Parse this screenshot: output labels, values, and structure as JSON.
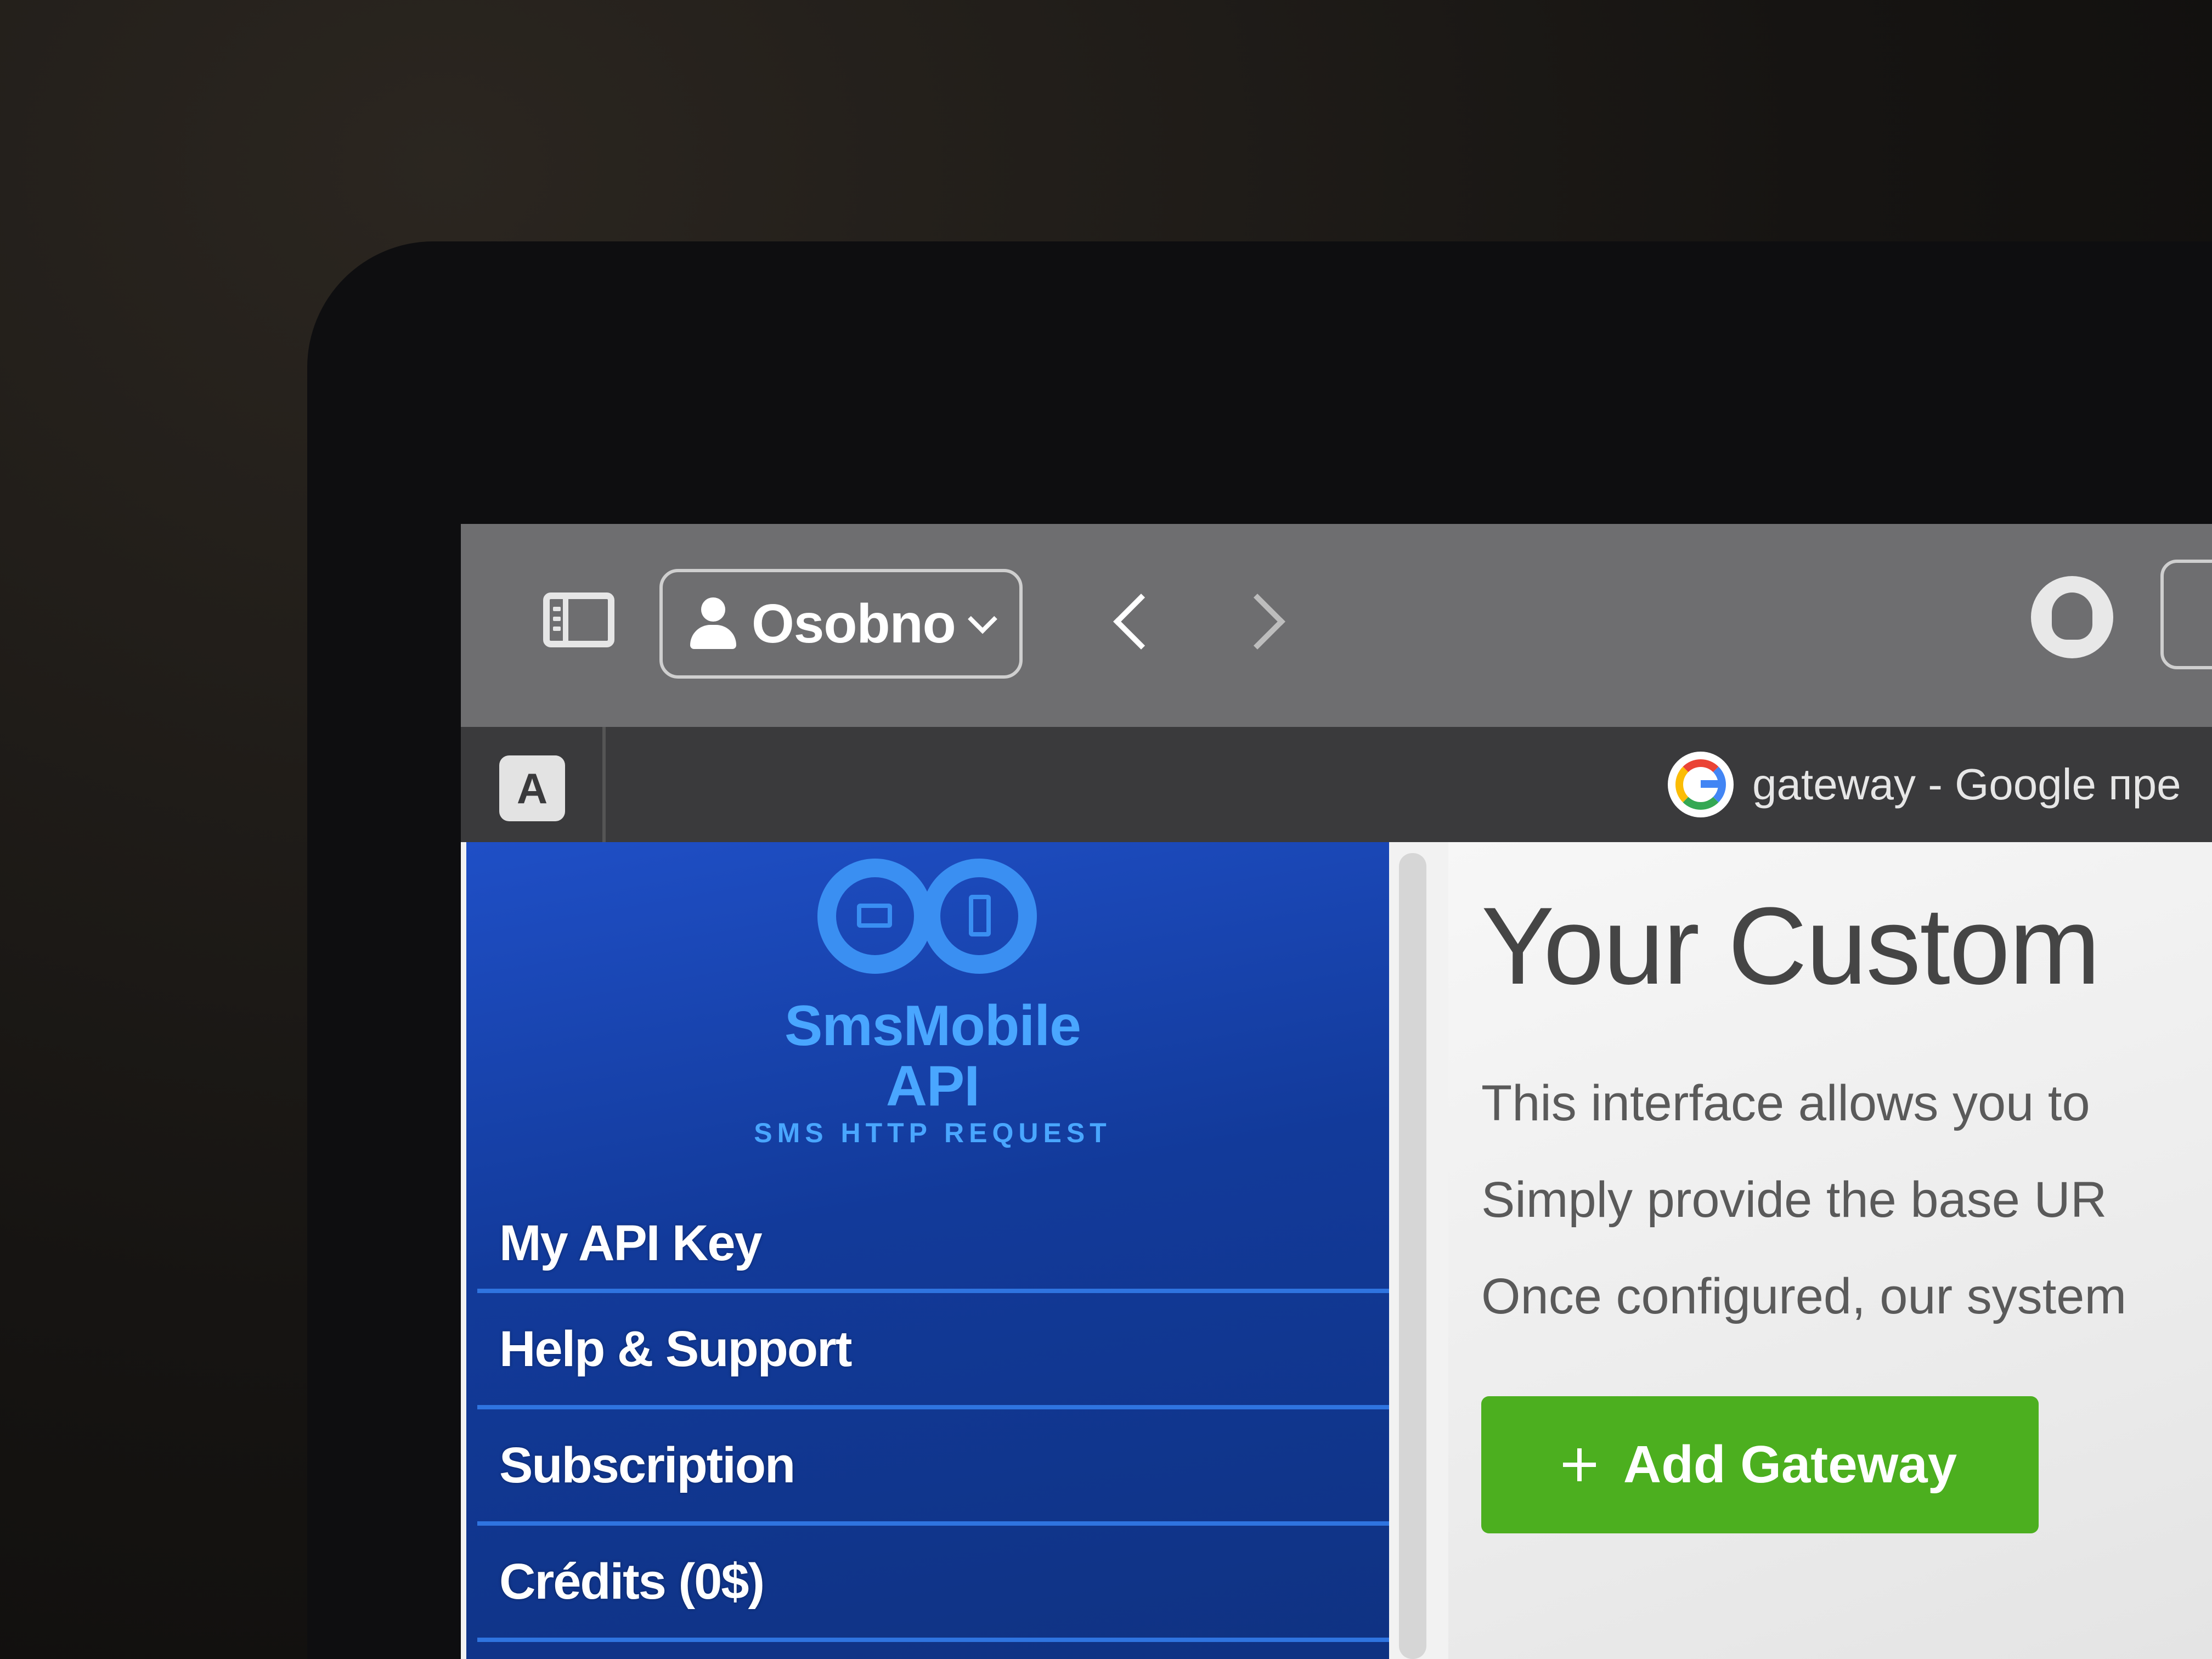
{
  "browser": {
    "profile_label": "Osobno",
    "pinned_tab_letter": "A",
    "active_tab_title": "gateway - Google пре"
  },
  "sidebar": {
    "logo_name": "SmsMobile API",
    "logo_tagline": "SMS HTTP REQUEST",
    "items": [
      {
        "label": "My API Key"
      },
      {
        "label": "Help & Support"
      },
      {
        "label": "Subscription"
      },
      {
        "label": "Crédits (0$)"
      }
    ]
  },
  "main": {
    "title": "Your Custom",
    "intro_lines": [
      "This interface allows you to",
      "Simply provide the base UR",
      "Once configured, our system"
    ],
    "add_gateway_label": "Add Gateway"
  },
  "icons": {
    "sidebar_toggle": "sidebar-toggle-icon",
    "profile": "person-icon",
    "back": "chevron-left-icon",
    "forward": "chevron-right-icon",
    "extension": "github-icon",
    "reader": "reader-icon",
    "tab_favicon": "google-g-icon",
    "add": "plus-icon"
  },
  "colors": {
    "sidebar_blue": "#1f4fc6",
    "accent_green": "#4caf1f",
    "logo_blue": "#49a6ff"
  }
}
